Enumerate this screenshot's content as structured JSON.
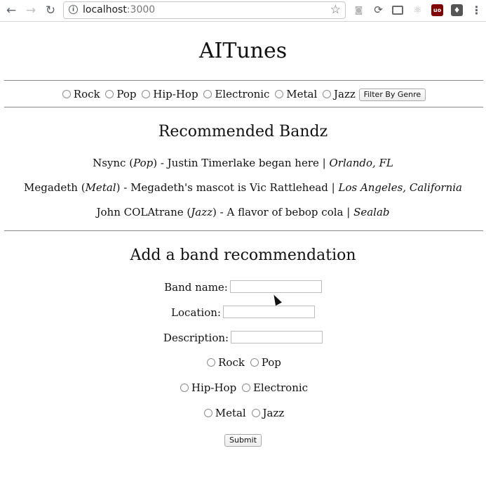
{
  "browser": {
    "url_host": "localhost",
    "url_port": ":3000",
    "back_icon": "←",
    "forward_icon": "→",
    "reload_icon": "↻",
    "star_icon": "☆",
    "info_icon": "i",
    "menu_icon": "⋮",
    "extensions": [
      "camera-icon",
      "sync-icon",
      "cast-icon",
      "react-icon",
      "ublock-icon",
      "bulb-icon"
    ],
    "ublock_label": "uo",
    "bulb_label": "💡"
  },
  "app": {
    "title": "AITunes"
  },
  "filter": {
    "genres": [
      "Rock",
      "Pop",
      "Hip-Hop",
      "Electronic",
      "Metal",
      "Jazz"
    ],
    "button_label": "Filter By Genre"
  },
  "recommended": {
    "heading": "Recommended Bandz",
    "bands": [
      {
        "name": "Nsync",
        "genre": "Pop",
        "description": "Justin Timerlake began here",
        "location": "Orlando, FL"
      },
      {
        "name": "Megadeth",
        "genre": "Metal",
        "description": "Megadeth's mascot is Vic Rattlehead",
        "location": "Los Angeles, California"
      },
      {
        "name": "John COLAtrane",
        "genre": "Jazz",
        "description": "A flavor of bebop cola",
        "location": "Sealab"
      }
    ]
  },
  "add_form": {
    "heading": "Add a band recommendation",
    "band_name_label": "Band name:",
    "location_label": "Location:",
    "description_label": "Description:",
    "band_name_value": "",
    "location_value": "",
    "description_value": "",
    "genre_rows": [
      [
        "Rock",
        "Pop"
      ],
      [
        "Hip-Hop",
        "Electronic"
      ],
      [
        "Metal",
        "Jazz"
      ]
    ],
    "submit_label": "Submit"
  }
}
